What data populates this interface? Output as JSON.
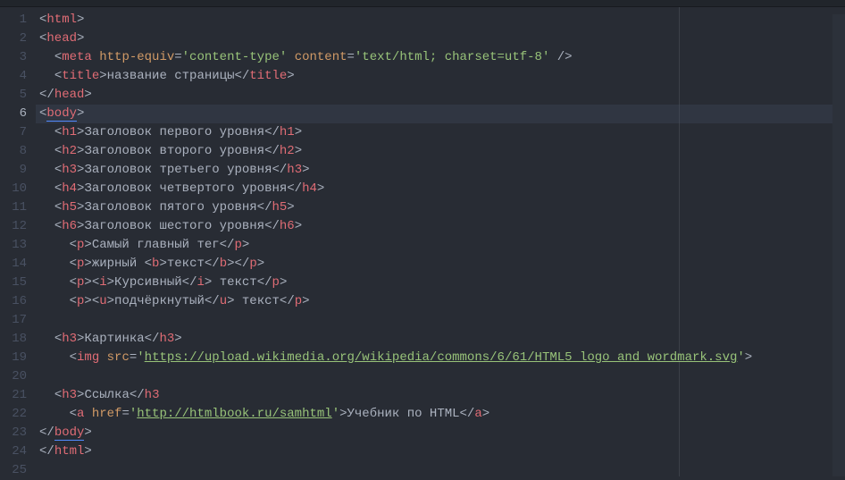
{
  "activeLine": 6,
  "lines": [
    {
      "n": 1,
      "indent": 0,
      "tokens": [
        [
          "p",
          "<"
        ],
        [
          "t",
          "html"
        ],
        [
          "p",
          ">"
        ]
      ]
    },
    {
      "n": 2,
      "indent": 0,
      "tokens": [
        [
          "p",
          "<"
        ],
        [
          "t",
          "head"
        ],
        [
          "p",
          ">"
        ]
      ]
    },
    {
      "n": 3,
      "indent": 1,
      "tokens": [
        [
          "p",
          "<"
        ],
        [
          "t",
          "meta"
        ],
        [
          "tx",
          " "
        ],
        [
          "a",
          "http-equiv"
        ],
        [
          "eq",
          "="
        ],
        [
          "s",
          "'content-type'"
        ],
        [
          "tx",
          " "
        ],
        [
          "a",
          "content"
        ],
        [
          "eq",
          "="
        ],
        [
          "s",
          "'text/html; charset=utf-8'"
        ],
        [
          "tx",
          " "
        ],
        [
          "p",
          "/>"
        ]
      ]
    },
    {
      "n": 4,
      "indent": 1,
      "tokens": [
        [
          "p",
          "<"
        ],
        [
          "t",
          "title"
        ],
        [
          "p",
          ">"
        ],
        [
          "tx",
          "название страницы"
        ],
        [
          "p",
          "</"
        ],
        [
          "t",
          "title"
        ],
        [
          "p",
          ">"
        ]
      ]
    },
    {
      "n": 5,
      "indent": 0,
      "tokens": [
        [
          "p",
          "</"
        ],
        [
          "t",
          "head"
        ],
        [
          "p",
          ">"
        ]
      ]
    },
    {
      "n": 6,
      "indent": 0,
      "tokens": [
        [
          "p",
          "<"
        ],
        [
          "t",
          "body",
          "lb"
        ],
        [
          "p",
          ">"
        ]
      ]
    },
    {
      "n": 7,
      "indent": 1,
      "tokens": [
        [
          "p",
          "<"
        ],
        [
          "t",
          "h1"
        ],
        [
          "p",
          ">"
        ],
        [
          "tx",
          "Заголовок первого уровня"
        ],
        [
          "p",
          "</"
        ],
        [
          "t",
          "h1"
        ],
        [
          "p",
          ">"
        ]
      ]
    },
    {
      "n": 8,
      "indent": 1,
      "tokens": [
        [
          "p",
          "<"
        ],
        [
          "t",
          "h2"
        ],
        [
          "p",
          ">"
        ],
        [
          "tx",
          "Заголовок второго уровня"
        ],
        [
          "p",
          "</"
        ],
        [
          "t",
          "h2"
        ],
        [
          "p",
          ">"
        ]
      ]
    },
    {
      "n": 9,
      "indent": 1,
      "tokens": [
        [
          "p",
          "<"
        ],
        [
          "t",
          "h3"
        ],
        [
          "p",
          ">"
        ],
        [
          "tx",
          "Заголовок третьего уровня"
        ],
        [
          "p",
          "</"
        ],
        [
          "t",
          "h3"
        ],
        [
          "p",
          ">"
        ]
      ]
    },
    {
      "n": 10,
      "indent": 1,
      "tokens": [
        [
          "p",
          "<"
        ],
        [
          "t",
          "h4"
        ],
        [
          "p",
          ">"
        ],
        [
          "tx",
          "Заголовок четвертого уровня"
        ],
        [
          "p",
          "</"
        ],
        [
          "t",
          "h4"
        ],
        [
          "p",
          ">"
        ]
      ]
    },
    {
      "n": 11,
      "indent": 1,
      "tokens": [
        [
          "p",
          "<"
        ],
        [
          "t",
          "h5"
        ],
        [
          "p",
          ">"
        ],
        [
          "tx",
          "Заголовок пятого уровня"
        ],
        [
          "p",
          "</"
        ],
        [
          "t",
          "h5"
        ],
        [
          "p",
          ">"
        ]
      ]
    },
    {
      "n": 12,
      "indent": 1,
      "tokens": [
        [
          "p",
          "<"
        ],
        [
          "t",
          "h6"
        ],
        [
          "p",
          ">"
        ],
        [
          "tx",
          "Заголовок шестого уровня"
        ],
        [
          "p",
          "</"
        ],
        [
          "t",
          "h6"
        ],
        [
          "p",
          ">"
        ]
      ]
    },
    {
      "n": 13,
      "indent": 2,
      "tokens": [
        [
          "p",
          "<"
        ],
        [
          "t",
          "p"
        ],
        [
          "p",
          ">"
        ],
        [
          "tx",
          "Самый главный тег"
        ],
        [
          "p",
          "</"
        ],
        [
          "t",
          "p"
        ],
        [
          "p",
          ">"
        ]
      ]
    },
    {
      "n": 14,
      "indent": 2,
      "tokens": [
        [
          "p",
          "<"
        ],
        [
          "t",
          "p"
        ],
        [
          "p",
          ">"
        ],
        [
          "tx",
          "жирный "
        ],
        [
          "p",
          "<"
        ],
        [
          "t",
          "b"
        ],
        [
          "p",
          ">"
        ],
        [
          "tx",
          "текст"
        ],
        [
          "p",
          "</"
        ],
        [
          "t",
          "b"
        ],
        [
          "p",
          ">"
        ],
        [
          "p",
          "</"
        ],
        [
          "t",
          "p"
        ],
        [
          "p",
          ">"
        ]
      ]
    },
    {
      "n": 15,
      "indent": 2,
      "tokens": [
        [
          "p",
          "<"
        ],
        [
          "t",
          "p"
        ],
        [
          "p",
          ">"
        ],
        [
          "p",
          "<"
        ],
        [
          "t",
          "i"
        ],
        [
          "p",
          ">"
        ],
        [
          "tx",
          "Курсивный"
        ],
        [
          "p",
          "</"
        ],
        [
          "t",
          "i"
        ],
        [
          "p",
          ">"
        ],
        [
          "tx",
          " текст"
        ],
        [
          "p",
          "</"
        ],
        [
          "t",
          "p"
        ],
        [
          "p",
          ">"
        ]
      ]
    },
    {
      "n": 16,
      "indent": 2,
      "tokens": [
        [
          "p",
          "<"
        ],
        [
          "t",
          "p"
        ],
        [
          "p",
          ">"
        ],
        [
          "p",
          "<"
        ],
        [
          "t",
          "u"
        ],
        [
          "p",
          ">"
        ],
        [
          "tx",
          "подчёркнутый"
        ],
        [
          "p",
          "</"
        ],
        [
          "t",
          "u"
        ],
        [
          "p",
          ">"
        ],
        [
          "tx",
          " текст"
        ],
        [
          "p",
          "</"
        ],
        [
          "t",
          "p"
        ],
        [
          "p",
          ">"
        ]
      ]
    },
    {
      "n": 17,
      "indent": 0,
      "tokens": []
    },
    {
      "n": 18,
      "indent": 1,
      "tokens": [
        [
          "p",
          "<"
        ],
        [
          "t",
          "h3"
        ],
        [
          "p",
          ">"
        ],
        [
          "tx",
          "Картинка"
        ],
        [
          "p",
          "</"
        ],
        [
          "t",
          "h3"
        ],
        [
          "p",
          ">"
        ]
      ]
    },
    {
      "n": 19,
      "indent": 2,
      "tokens": [
        [
          "p",
          "<"
        ],
        [
          "t",
          "img"
        ],
        [
          "tx",
          " "
        ],
        [
          "a",
          "src"
        ],
        [
          "eq",
          "="
        ],
        [
          "s",
          "'"
        ],
        [
          "s",
          "https://upload.wikimedia.org/wikipedia/commons/6/61/HTML5_logo_and_wordmark.svg",
          "u"
        ],
        [
          "s",
          "'"
        ],
        [
          "p",
          ">"
        ]
      ]
    },
    {
      "n": 20,
      "indent": 0,
      "tokens": []
    },
    {
      "n": 21,
      "indent": 1,
      "tokens": [
        [
          "p",
          "<"
        ],
        [
          "t",
          "h3"
        ],
        [
          "p",
          ">"
        ],
        [
          "tx",
          "Ссылка"
        ],
        [
          "p",
          "</"
        ],
        [
          "t",
          "h3"
        ]
      ]
    },
    {
      "n": 22,
      "indent": 2,
      "tokens": [
        [
          "p",
          "<"
        ],
        [
          "t",
          "a"
        ],
        [
          "tx",
          " "
        ],
        [
          "a",
          "href"
        ],
        [
          "eq",
          "="
        ],
        [
          "s",
          "'"
        ],
        [
          "s",
          "http://htmlbook.ru/samhtml",
          "u"
        ],
        [
          "s",
          "'"
        ],
        [
          "p",
          ">"
        ],
        [
          "tx",
          "Учебник по HTML"
        ],
        [
          "p",
          "</"
        ],
        [
          "t",
          "a"
        ],
        [
          "p",
          ">"
        ]
      ]
    },
    {
      "n": 23,
      "indent": 0,
      "tokens": [
        [
          "p",
          "</"
        ],
        [
          "t",
          "body",
          "lb"
        ],
        [
          "p",
          ">"
        ]
      ]
    },
    {
      "n": 24,
      "indent": 0,
      "tokens": [
        [
          "p",
          "</"
        ],
        [
          "t",
          "html"
        ],
        [
          "p",
          ">"
        ]
      ]
    },
    {
      "n": 25,
      "indent": 0,
      "tokens": []
    }
  ]
}
